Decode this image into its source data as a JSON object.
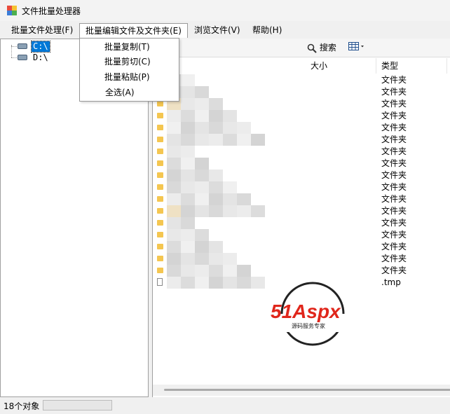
{
  "window": {
    "title": "文件批量处理器"
  },
  "menubar": {
    "items": [
      {
        "label": "批量文件处理(F)"
      },
      {
        "label": "批量编辑文件及文件夹(E)"
      },
      {
        "label": "浏览文件(V)"
      },
      {
        "label": "帮助(H)"
      }
    ]
  },
  "edit_menu": {
    "items": [
      {
        "label": "批量复制(T)"
      },
      {
        "label": "批量剪切(C)"
      },
      {
        "label": "批量粘贴(P)"
      },
      {
        "label": "全选(A)"
      }
    ]
  },
  "tree": {
    "drives": [
      {
        "label": "C:\\",
        "selected": true
      },
      {
        "label": "D:\\",
        "selected": false
      }
    ]
  },
  "toolbar": {
    "search_label": "搜索",
    "search_icon": "magnifier-icon",
    "view_icon": "grid-view-icon"
  },
  "columns": {
    "size": "大小",
    "type": "类型"
  },
  "files": [
    {
      "kind": "folder",
      "type": "文件夹"
    },
    {
      "kind": "folder",
      "type": "文件夹"
    },
    {
      "kind": "folder",
      "type": "文件夹"
    },
    {
      "kind": "folder",
      "type": "文件夹"
    },
    {
      "kind": "folder",
      "type": "文件夹"
    },
    {
      "kind": "folder",
      "type": "文件夹"
    },
    {
      "kind": "folder",
      "type": "文件夹"
    },
    {
      "kind": "folder",
      "type": "文件夹"
    },
    {
      "kind": "folder",
      "type": "文件夹"
    },
    {
      "kind": "folder",
      "type": "文件夹"
    },
    {
      "kind": "folder",
      "type": "文件夹"
    },
    {
      "kind": "folder",
      "type": "文件夹"
    },
    {
      "kind": "folder",
      "type": "文件夹"
    },
    {
      "kind": "folder",
      "type": "文件夹"
    },
    {
      "kind": "folder",
      "type": "文件夹"
    },
    {
      "kind": "folder",
      "type": "文件夹"
    },
    {
      "kind": "folder",
      "type": "文件夹"
    },
    {
      "kind": "file",
      "type": ".tmp"
    }
  ],
  "watermark": {
    "brand": "51Aspx",
    "tagline": "源码服务专家"
  },
  "status": {
    "text": "18个对象"
  },
  "colors": {
    "selection": "#0078d7",
    "folder": "#f4c650",
    "watermark_red": "#e0261b",
    "watermark_green": "#3aa53a"
  }
}
